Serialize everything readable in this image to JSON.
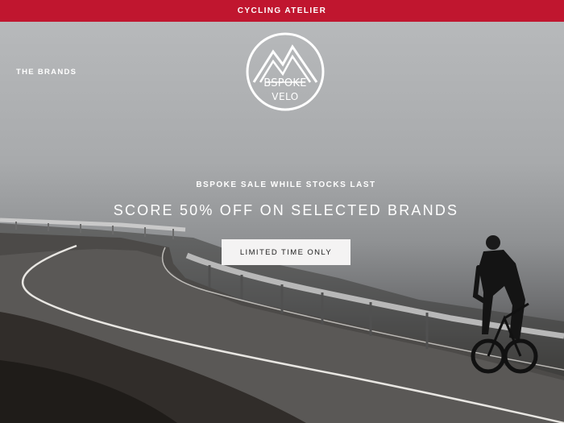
{
  "announcement_bar": {
    "text": "CYCLING ATELIER",
    "background": "#c0162f"
  },
  "header": {
    "nav_link": "THE BRANDS",
    "logo": {
      "line1": "BSPOKE",
      "line2": "VELO"
    }
  },
  "hero": {
    "sub_headline": "BSPOKE SALE WHILE STOCKS LAST",
    "headline": "SCORE 50% OFF ON SELECTED BRANDS",
    "cta_label": "LIMITED TIME ONLY",
    "image_description": "cyclist-on-mountain-road"
  }
}
